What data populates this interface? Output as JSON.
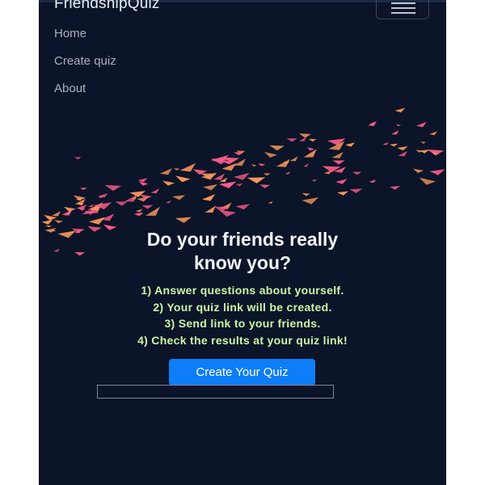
{
  "navbar": {
    "brand": "FriendshipQuiz",
    "links": [
      "Home",
      "Create quiz",
      "About"
    ]
  },
  "hero": {
    "title_line1": "Do your friends really",
    "title_line2": "know you?",
    "steps": [
      "1) Answer questions about yourself.",
      "2) Your quiz link will be created.",
      "3) Send link to your friends.",
      "4) Check the results at your quiz link!"
    ],
    "cta_label": "Create Your Quiz"
  },
  "colors": {
    "background": "#0b1428",
    "steps_text": "#c8f7a6",
    "button": "#0d7ef7",
    "bird_pink": "#ff5c8a",
    "bird_orange": "#ff9a5c"
  },
  "icons": {
    "menu": "hamburger-menu-icon",
    "decoration": "paper-birds-flock"
  }
}
